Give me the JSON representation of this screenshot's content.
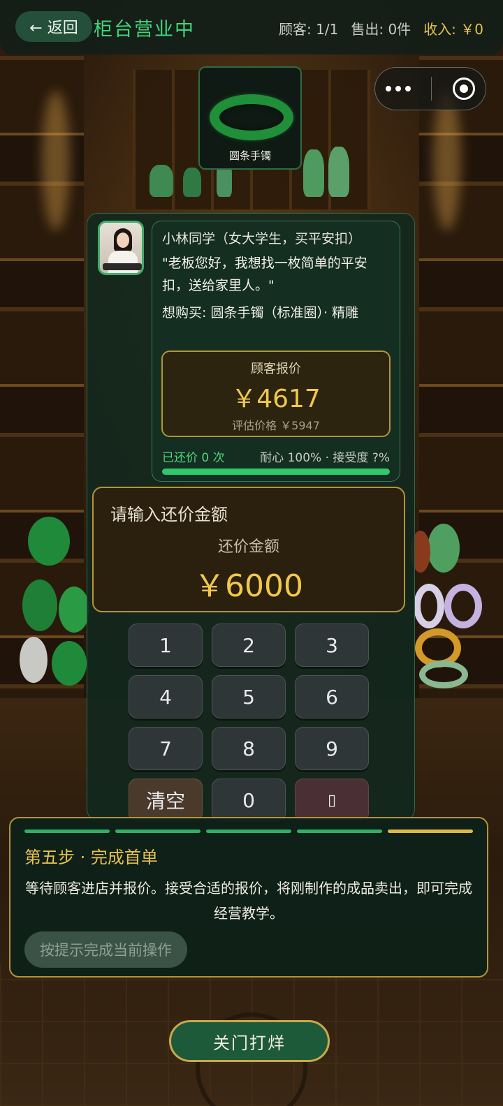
{
  "header": {
    "back_label": "← 返回",
    "title": "柜台营业中",
    "customers": "顾客: 1/1",
    "sold": "售出: 0件",
    "income": "收入: ￥0"
  },
  "product": {
    "label": "圆条手镯"
  },
  "customer": {
    "name": "小林同学（女大学生，买平安扣）",
    "quote": "\"老板您好，我想找一枚简单的平安扣，送给家里人。\"",
    "want": "想购买: 圆条手镯（标准圈）· 精雕",
    "offer_label": "顾客报价",
    "offer_value": "￥4617",
    "estimate": "评估价格 ￥5947",
    "counter_count": "已还价 0 次",
    "status": "耐心 100% · 接受度 ?%",
    "patience": 1.0
  },
  "counter": {
    "heading": "请输入还价金额",
    "label": "还价金额",
    "value": "￥6000"
  },
  "keypad": {
    "k1": "1",
    "k2": "2",
    "k3": "3",
    "k4": "4",
    "k5": "5",
    "k6": "6",
    "k7": "7",
    "k8": "8",
    "k9": "9",
    "clear": "清空",
    "k0": "0",
    "del": "▯"
  },
  "tutorial": {
    "title": "第五步 · 完成首单",
    "text": "等待顾客进店并报价。接受合适的报价，将刚制作的成品卖出，即可完成经营教学。",
    "button": "按提示完成当前操作",
    "steps_total": 5,
    "current_step": 5
  },
  "footer": {
    "close_label": "关门打烊"
  },
  "colors": {
    "accent_green": "#3fd77b",
    "gold": "#e8c252",
    "panel_bg": "#12281e"
  }
}
